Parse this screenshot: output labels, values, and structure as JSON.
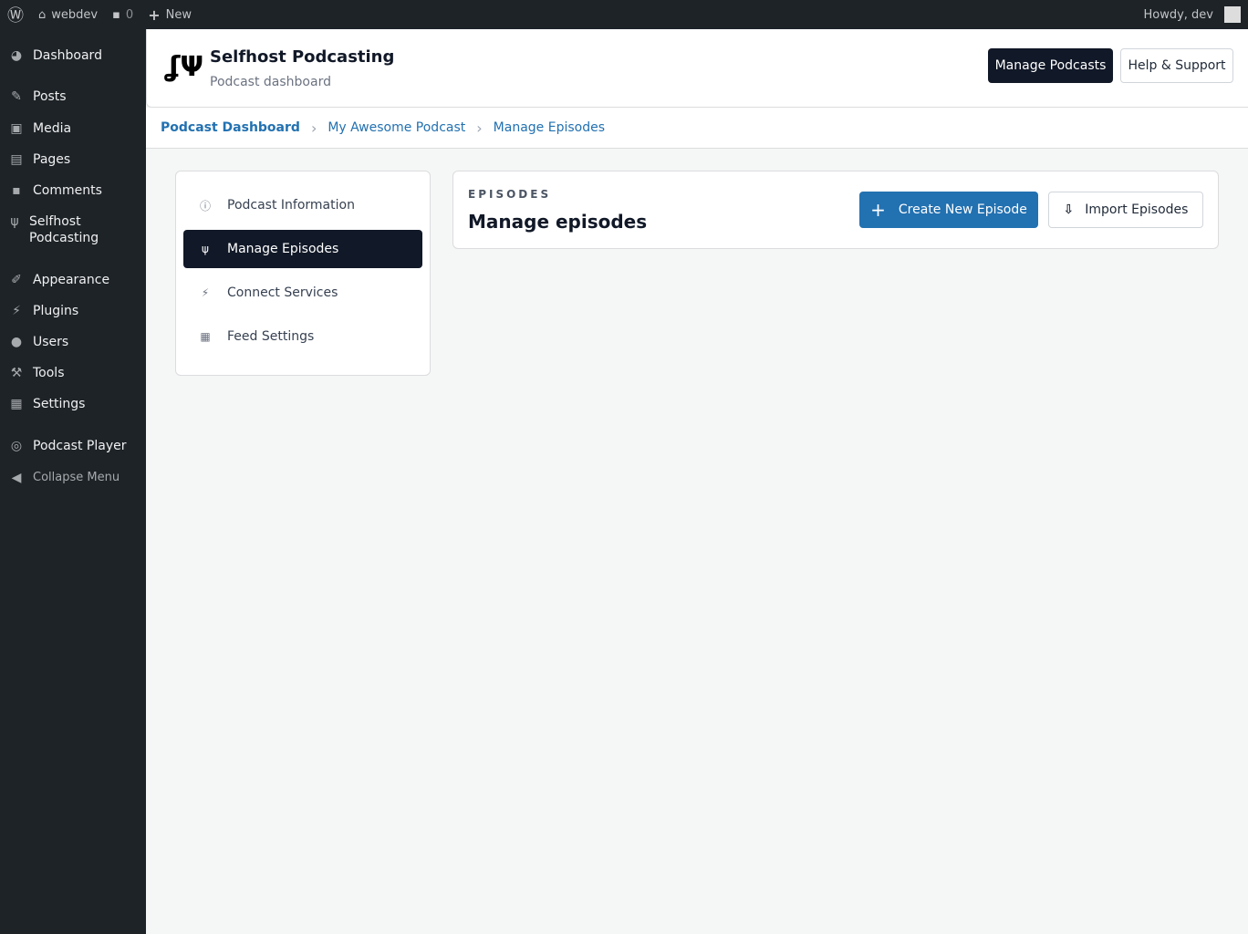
{
  "adminbar": {
    "site": "webdev",
    "comments": "0",
    "new": "New",
    "howdy": "Howdy, dev"
  },
  "menu": [
    {
      "label": "Dashboard",
      "icon": "dashboard-icon"
    },
    {
      "label": "Posts",
      "icon": "pin-icon"
    },
    {
      "label": "Media",
      "icon": "media-icon"
    },
    {
      "label": "Pages",
      "icon": "page-icon"
    },
    {
      "label": "Comments",
      "icon": "comment-icon"
    },
    {
      "label": "Selfhost Podcasting",
      "icon": "microphone-icon"
    },
    {
      "label": "Appearance",
      "icon": "brush-icon"
    },
    {
      "label": "Plugins",
      "icon": "plugin-icon"
    },
    {
      "label": "Users",
      "icon": "user-icon"
    },
    {
      "label": "Tools",
      "icon": "wrench-icon"
    },
    {
      "label": "Settings",
      "icon": "settings-icon"
    },
    {
      "label": "Podcast Player",
      "icon": "podcast-icon"
    },
    {
      "label": "Collapse Menu",
      "icon": "collapse-icon"
    }
  ],
  "header": {
    "title": "Selfhost Podcasting",
    "subtitle": "Podcast dashboard",
    "manage": "Manage Podcasts",
    "help": "Help & Support"
  },
  "breadcrumb": [
    "Podcast Dashboard",
    "My Awesome Podcast",
    "Manage Episodes"
  ],
  "nav": [
    {
      "label": "Podcast Information"
    },
    {
      "label": "Manage Episodes"
    },
    {
      "label": "Connect Services"
    },
    {
      "label": "Feed Settings"
    }
  ],
  "panel": {
    "eyebrow": "EPISODES",
    "title": "Manage episodes",
    "create": "Create New Episode",
    "import": "Import Episodes"
  }
}
